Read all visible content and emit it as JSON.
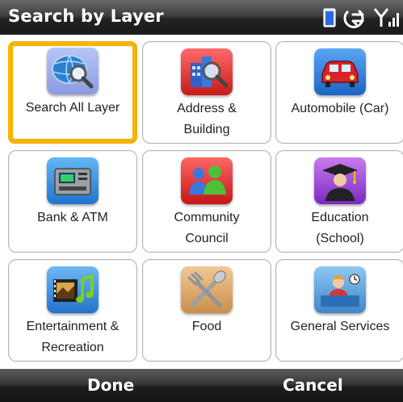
{
  "title_bar": {
    "title": "Search by Layer",
    "status_icons": [
      "battery-icon",
      "connectivity-icon",
      "signal-icon"
    ]
  },
  "tiles": [
    {
      "label_lines": [
        "Search All Layer"
      ],
      "icon": "globe-search-icon",
      "selected": true
    },
    {
      "label_lines": [
        "Address &",
        "Building"
      ],
      "icon": "building-search-icon",
      "selected": false
    },
    {
      "label_lines": [
        "Automobile (Car)"
      ],
      "icon": "car-icon",
      "selected": false
    },
    {
      "label_lines": [
        "Bank & ATM"
      ],
      "icon": "atm-icon",
      "selected": false
    },
    {
      "label_lines": [
        "Community",
        "Council"
      ],
      "icon": "community-icon",
      "selected": false
    },
    {
      "label_lines": [
        "Education",
        "(School)"
      ],
      "icon": "graduate-icon",
      "selected": false
    },
    {
      "label_lines": [
        "Entertainment &",
        "Recreation"
      ],
      "icon": "film-music-icon",
      "selected": false
    },
    {
      "label_lines": [
        "Food"
      ],
      "icon": "fork-spoon-icon",
      "selected": false
    },
    {
      "label_lines": [
        "General Services"
      ],
      "icon": "service-desk-icon",
      "selected": false
    }
  ],
  "softkeys": {
    "left": "Done",
    "right": "Cancel"
  },
  "colors": {
    "selection_border": "#f4b400",
    "bar_dark": "#222222",
    "text_light": "#ffffff"
  }
}
